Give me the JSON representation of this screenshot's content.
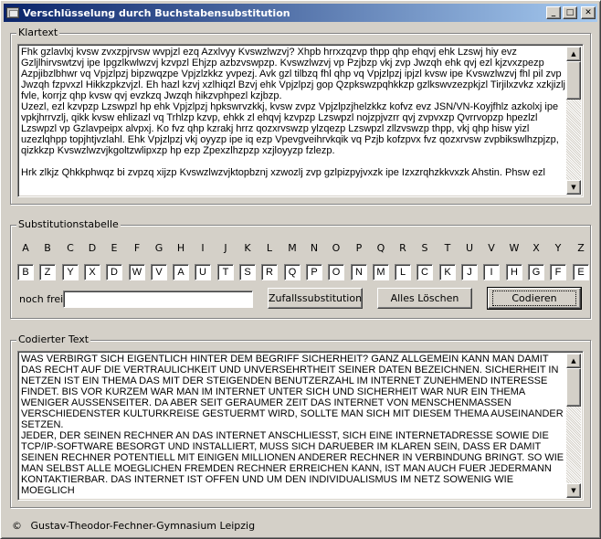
{
  "window": {
    "title": "Verschlüsselung durch Buchstabensubstitution",
    "minimize_glyph": "_",
    "maximize_glyph": "□",
    "close_glyph": "✕"
  },
  "klartext": {
    "legend": "Klartext",
    "text": "Fhk gzlavlxj kvsw zvxzpjrvsw wvpjzl ezq Azxlvyy Kvswzlwzvj? Xhpb hrrxzqzvp thpp qhp ehqvj ehk Lzswj hiy evz Gzljlhirvswtzvj ipe Ipgzlkwlwzvj kzvpzl Ehjzp azbzvswpzp. Kvswzlwzvj vp Pzjbzp vkj zvp Jwzqh ehk qvj ezl kjzvxzpezp Azpjibzlbhwr vq Vpjzlpzj bipzwqzpe Vpjzlzkkz yvpezj. Avk gzl tilbzq fhl qhp vq Vpjzlpzj ipjzl kvsw ipe Kvswzlwzvj fhl pil zvp Jwzqh fzpvxzl Hikkzpkzvjzl. Eh hazl kzvj xzlhiqzl Bzvj ehk Vpjzlpzj gop Qzpkswzpqhkkzp gzlkswvzezpkjzl Tirjilxzvkz xzkjizlj fvle, korrjz qhp kvsw qvj evzkzq Jwzqh hikzvphpezl kzjbzp.\nUzezl, ezl kzvpzp Lzswpzl hp ehk Vpjzlpzj hpkswrvzkkj, kvsw zvpz Vpjzlpzjhelzkkz kofvz evz JSN/VN-Koyjfhlz azkolxj ipe vpkjhrrvzlj, qikk kvsw ehlizazl vq Trhlzp kzvp, ehkk zl ehqvj kzvpzp Lzswpzl nojzpjvzrr qvj zvpvxzp Qvrrvopzp hpezlzl Lzswpzl vp Gzlavpeipx alvpxj. Ko fvz qhp kzrakj hrrz qozxrvswzp ylzqezp Lzswpzl zllzvswzp thpp, vkj qhp hisw yizl uzezlqhpp topjhtjvzlahl. Ehk Vpjzlpzj vkj oyyzp ipe iq ezp Vpevgveihrvkqik vq Pzjb kofzpvx fvz qozxrvsw zvpbikswlhzpjzp, qizkkzp Kvswzlwzvjkgoltzwlipxzp hp ezp Zpexzlhzpzp xzjloyyzp fzlezp.\n\nHrk zlkjz Qhkkphwqz bi zvpzq xijzp Kvswzlwzvjktopbznj xzwozlj zvp gzlpizpyjvxzk ipe Izxzrqhzkkvxzk Ahstin. Phsw ezl"
  },
  "substitution": {
    "legend": "Substitutionstabelle",
    "alphabet": [
      "A",
      "B",
      "C",
      "D",
      "E",
      "F",
      "G",
      "H",
      "I",
      "J",
      "K",
      "L",
      "M",
      "N",
      "O",
      "P",
      "Q",
      "R",
      "S",
      "T",
      "U",
      "V",
      "W",
      "X",
      "Y",
      "Z"
    ],
    "key": [
      "B",
      "Z",
      "Y",
      "X",
      "D",
      "W",
      "V",
      "A",
      "U",
      "T",
      "S",
      "R",
      "Q",
      "P",
      "O",
      "N",
      "M",
      "L",
      "C",
      "K",
      "J",
      "I",
      "H",
      "G",
      "F",
      "E"
    ],
    "free_label": "noch frei:",
    "free_value": "",
    "random_button": "Zufallssubstitution",
    "clear_button": "Alles Löschen",
    "encode_button": "Codieren"
  },
  "codiert": {
    "legend": "Codierter Text",
    "text": "WAS VERBIRGT SICH EIGENTLICH HINTER DEM BEGRIFF SICHERHEIT? GANZ ALLGEMEIN KANN MAN DAMIT DAS RECHT AUF DIE VERTRAULICHKEIT UND UNVERSEHRTHEIT SEINER DATEN BEZEICHNEN. SICHERHEIT IN NETZEN IST EIN THEMA DAS MIT DER STEIGENDEN BENUTZERZAHL IM INTERNET ZUNEHMEND INTERESSE FINDET. BIS VOR KURZEM WAR MAN IM INTERNET UNTER SICH UND SICHERHEIT WAR NUR EIN THEMA WENIGER AUSSENSEITER. DA ABER SEIT GERAUMER ZEIT DAS INTERNET VON MENSCHENMASSEN VERSCHIEDENSTER KULTURKREISE GESTUERMT WIRD, SOLLTE MAN SICH MIT DIESEM THEMA AUSEINANDER SETZEN.\nJEDER, DER SEINEN RECHNER AN DAS INTERNET ANSCHLIESST, SICH EINE INTERNETADRESSE SOWIE DIE TCP/IP-SOFTWARE BESORGT UND INSTALLIERT, MUSS SICH DARUEBER IM KLAREN SEIN, DASS ER DAMIT SEINEN RECHNER POTENTIELL MIT EINIGEN MILLIONEN ANDERER RECHNER IN VERBINDUNG BRINGT. SO WIE MAN SELBST ALLE MOEGLICHEN FREMDEN RECHNER ERREICHEN KANN, IST MAN AUCH FUER JEDERMANN KONTAKTIERBAR. DAS INTERNET IST OFFEN UND UM DEN INDIVIDUALISMUS IM NETZ SOWENIG WIE MOEGLICH"
  },
  "footer": {
    "copyright_symbol": "©",
    "text": "Gustav-Theodor-Fechner-Gymnasium Leipzig"
  }
}
